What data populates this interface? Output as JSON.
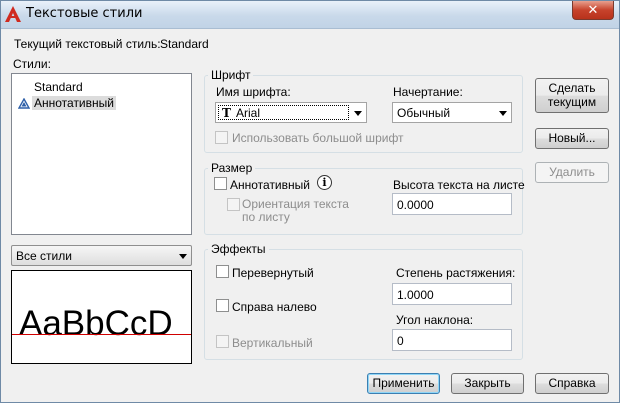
{
  "window": {
    "title": "Текстовые стили",
    "close_label": "✕"
  },
  "current_style": {
    "label": "Текущий текстовый стиль:",
    "value": "Standard"
  },
  "styles": {
    "label": "Стили:",
    "items": [
      {
        "name": "Standard",
        "selected": false,
        "annotative": false
      },
      {
        "name": "Аннотативный",
        "selected": true,
        "annotative": true
      }
    ],
    "filter_value": "Все стили"
  },
  "preview": {
    "sample_text": "AaBbCcD"
  },
  "font_group": {
    "title": "Шрифт",
    "font_name_label": "Имя шрифта:",
    "font_name_value": "Arial",
    "font_style_label": "Начертание:",
    "font_style_value": "Обычный",
    "big_font_label": "Использовать большой шрифт"
  },
  "size_group": {
    "title": "Размер",
    "annotative_label": "Аннотативный",
    "orientation_label_1": "Ориентация текста",
    "orientation_label_2": "по листу",
    "height_label": "Высота текста на листе",
    "height_value": "0.0000"
  },
  "effects_group": {
    "title": "Эффекты",
    "upside_down_label": "Перевернутый",
    "backwards_label": "Справа налево",
    "vertical_label": "Вертикальный",
    "width_factor_label": "Степень растяжения:",
    "width_factor_value": "1.0000",
    "oblique_label": "Угол наклона:",
    "oblique_value": "0"
  },
  "side_buttons": {
    "set_current_1": "Сделать",
    "set_current_2": "текущим",
    "new": "Новый...",
    "delete": "Удалить"
  },
  "bottom_buttons": {
    "apply": "Применить",
    "close": "Закрыть",
    "help": "Справка"
  }
}
